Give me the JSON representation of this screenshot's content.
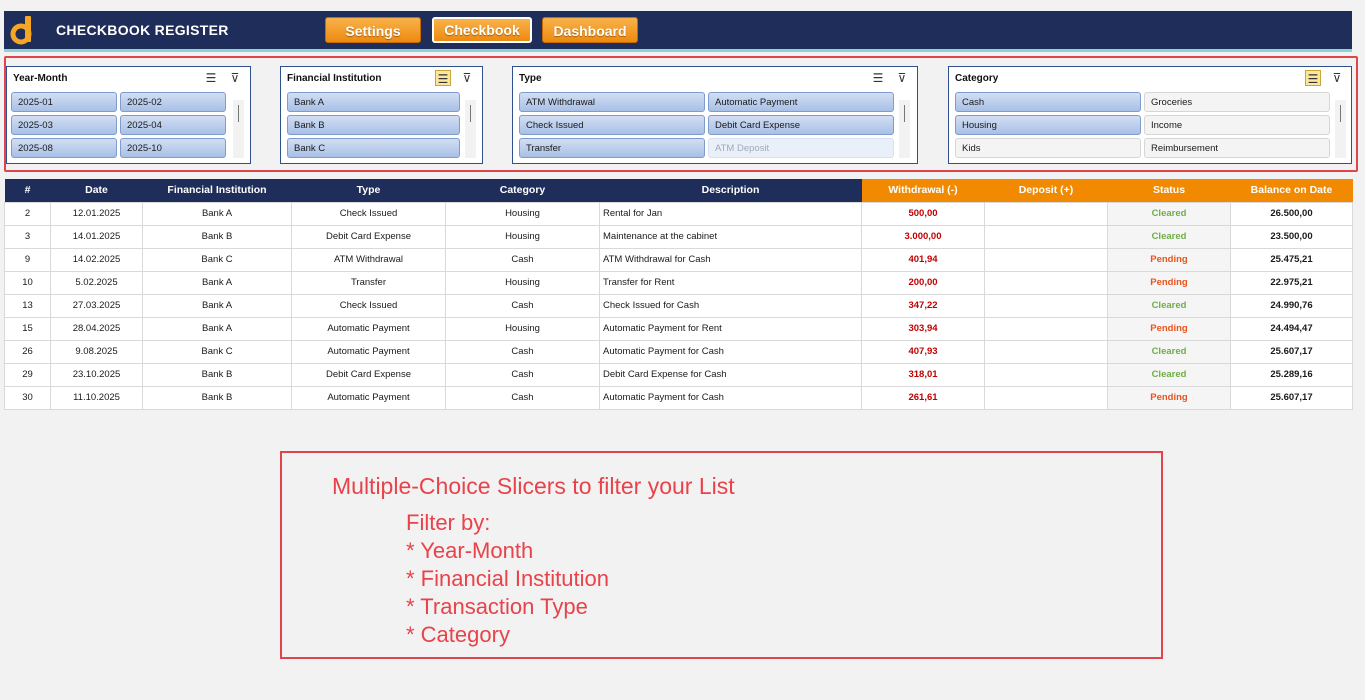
{
  "header": {
    "title": "CHECKBOOK REGISTER",
    "nav": [
      {
        "label": "Settings",
        "active": false
      },
      {
        "label": "Checkbook",
        "active": true
      },
      {
        "label": "Dashboard",
        "active": false
      }
    ],
    "colors": {
      "bar": "#1f2d5a",
      "accent": "#8fd3d0",
      "button": "#f18a00"
    }
  },
  "slicers": {
    "year_month": {
      "title": "Year-Month",
      "items": [
        "2025-01",
        "2025-02",
        "2025-03",
        "2025-04",
        "2025-08",
        "2025-10"
      ]
    },
    "institution": {
      "title": "Financial Institution",
      "items": [
        "Bank A",
        "Bank B",
        "Bank C"
      ]
    },
    "type": {
      "title": "Type",
      "items": [
        "ATM Withdrawal",
        "Automatic Payment",
        "Check Issued",
        "Debit Card Expense",
        "Transfer",
        "ATM Deposit"
      ]
    },
    "category": {
      "title": "Category",
      "items": [
        "Cash",
        "Groceries",
        "Housing",
        "Income",
        "Kids",
        "Reimbursement"
      ]
    }
  },
  "table": {
    "headers": [
      "#",
      "Date",
      "Financial Institution",
      "Type",
      "Category",
      "Description",
      "Withdrawal (-)",
      "Deposit (+)",
      "Status",
      "Balance on Date"
    ],
    "rows": [
      {
        "num": "2",
        "date": "12.01.2025",
        "inst": "Bank A",
        "type": "Check Issued",
        "cat": "Housing",
        "desc": "Rental for Jan",
        "wd": "500,00",
        "dep": "",
        "status": "Cleared",
        "bal": "26.500,00"
      },
      {
        "num": "3",
        "date": "14.01.2025",
        "inst": "Bank B",
        "type": "Debit Card Expense",
        "cat": "Housing",
        "desc": "Maintenance at the cabinet",
        "wd": "3.000,00",
        "dep": "",
        "status": "Cleared",
        "bal": "23.500,00"
      },
      {
        "num": "9",
        "date": "14.02.2025",
        "inst": "Bank C",
        "type": "ATM Withdrawal",
        "cat": "Cash",
        "desc": "ATM Withdrawal for Cash",
        "wd": "401,94",
        "dep": "",
        "status": "Pending",
        "bal": "25.475,21"
      },
      {
        "num": "10",
        "date": "5.02.2025",
        "inst": "Bank A",
        "type": "Transfer",
        "cat": "Housing",
        "desc": "Transfer for Rent",
        "wd": "200,00",
        "dep": "",
        "status": "Pending",
        "bal": "22.975,21"
      },
      {
        "num": "13",
        "date": "27.03.2025",
        "inst": "Bank A",
        "type": "Check Issued",
        "cat": "Cash",
        "desc": "Check Issued for Cash",
        "wd": "347,22",
        "dep": "",
        "status": "Cleared",
        "bal": "24.990,76"
      },
      {
        "num": "15",
        "date": "28.04.2025",
        "inst": "Bank A",
        "type": "Automatic Payment",
        "cat": "Housing",
        "desc": "Automatic Payment for Rent",
        "wd": "303,94",
        "dep": "",
        "status": "Pending",
        "bal": "24.494,47"
      },
      {
        "num": "26",
        "date": "9.08.2025",
        "inst": "Bank C",
        "type": "Automatic Payment",
        "cat": "Cash",
        "desc": "Automatic Payment for Cash",
        "wd": "407,93",
        "dep": "",
        "status": "Cleared",
        "bal": "25.607,17"
      },
      {
        "num": "29",
        "date": "23.10.2025",
        "inst": "Bank B",
        "type": "Debit Card Expense",
        "cat": "Cash",
        "desc": "Debit Card Expense for Cash",
        "wd": "318,01",
        "dep": "",
        "status": "Cleared",
        "bal": "25.289,16"
      },
      {
        "num": "30",
        "date": "11.10.2025",
        "inst": "Bank B",
        "type": "Automatic Payment",
        "cat": "Cash",
        "desc": "Automatic Payment for Cash",
        "wd": "261,61",
        "dep": "",
        "status": "Pending",
        "bal": "25.607,17"
      }
    ]
  },
  "note": {
    "title": "Multiple-Choice Slicers to filter your List",
    "lines": [
      "Filter by:",
      "* Year-Month",
      "* Financial Institution",
      "* Transaction Type",
      "* Category"
    ]
  }
}
